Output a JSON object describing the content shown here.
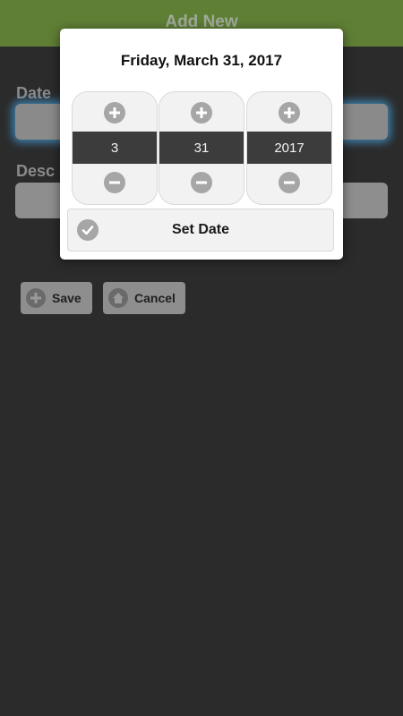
{
  "header": {
    "title": "Add New"
  },
  "form": {
    "date_label": "Date",
    "description_label": "Desc"
  },
  "buttons": {
    "save": "Save",
    "cancel": "Cancel"
  },
  "date_picker": {
    "title": "Friday, March 31, 2017",
    "columns": [
      {
        "value": "3"
      },
      {
        "value": "31"
      },
      {
        "value": "2017"
      }
    ],
    "set_label": "Set Date"
  },
  "colors": {
    "header": "#5f7f35",
    "background": "#2b2b2b",
    "dialog": "#ffffff",
    "value_band": "#3c3c3c"
  },
  "icons": [
    "plus-icon",
    "minus-icon",
    "check-icon",
    "home-icon"
  ]
}
